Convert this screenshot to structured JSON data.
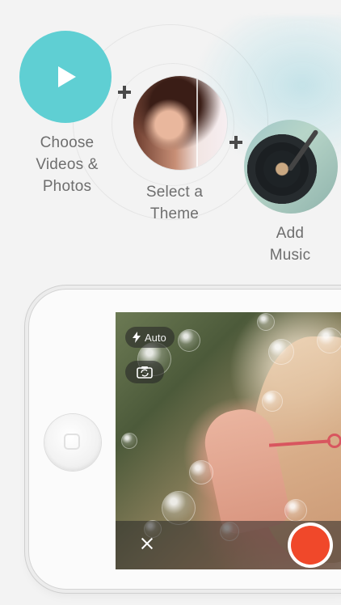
{
  "steps": [
    {
      "label_lines": [
        "Choose",
        "Videos &",
        "Photos"
      ],
      "icon": "play-icon"
    },
    {
      "label_lines": [
        "Select a",
        "Theme"
      ],
      "icon": "theme-photo"
    },
    {
      "label_lines": [
        "Add",
        "Music"
      ],
      "icon": "vinyl-photo"
    }
  ],
  "camera": {
    "flash_label": "Auto",
    "flash_icon": "lightning-bolt-icon",
    "switch_icon": "camera-switch-icon",
    "close_icon": "close-icon",
    "record_color": "#f0482a"
  },
  "colors": {
    "accent": "#5fcfd3",
    "label_text": "#6e6e6e",
    "plus": "#4a4a4a"
  }
}
